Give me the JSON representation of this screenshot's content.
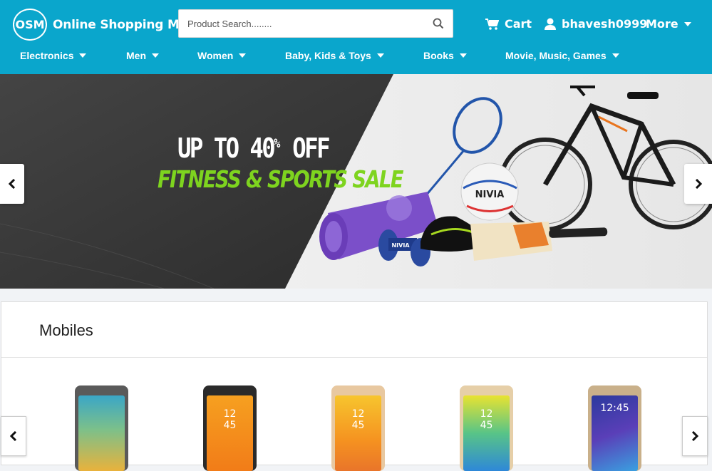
{
  "header": {
    "brand_initials": "OSM",
    "brand_name": "Online Shopping Mall",
    "search_placeholder": "Product Search........",
    "cart_label": "Cart",
    "user_label": "bhavesh0999",
    "more_label": "More"
  },
  "nav": {
    "items": [
      {
        "label": "Electronics"
      },
      {
        "label": "Men"
      },
      {
        "label": "Women"
      },
      {
        "label": "Baby, Kids & Toys"
      },
      {
        "label": "Books"
      },
      {
        "label": "Movie, Music, Games"
      }
    ]
  },
  "banner": {
    "line1_prefix": "UP TO 40",
    "line1_percent": "%",
    "line1_suffix": " OFF",
    "line2": "FITNESS & SPORTS SALE",
    "brand_ball": "NIVIA",
    "brand_dumbbell": "NIVIA"
  },
  "mobiles": {
    "title": "Mobiles",
    "products": [
      {
        "screen_text": ""
      },
      {
        "screen_text": "12\n45"
      },
      {
        "screen_text": "12\n45"
      },
      {
        "screen_text": "12\n45"
      },
      {
        "screen_text": "12:45"
      }
    ]
  },
  "colors": {
    "header_bg": "#0aa6cc",
    "sale_green": "#7ed41f",
    "banner_dark": "#3a3a3a"
  },
  "icons": {
    "search": "search-icon",
    "cart": "cart-icon",
    "user": "user-icon",
    "prev": "chevron-left-icon",
    "next": "chevron-right-icon"
  }
}
